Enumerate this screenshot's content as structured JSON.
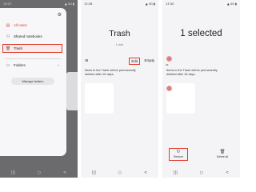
{
  "status": {
    "p1_time": "13:27",
    "p2_time": "13:28",
    "p3_time": "13:30",
    "system_right": "▲ 4G ▮"
  },
  "drawer": {
    "settings_icon": "gear-icon",
    "items": [
      {
        "label": "All notes",
        "icon": "note-icon"
      },
      {
        "label": "Shared notebooks",
        "icon": "people-icon"
      },
      {
        "label": "Trash",
        "icon": "trash-icon"
      },
      {
        "label": "Folders",
        "icon": "folder-icon"
      }
    ],
    "manage_folders": "Manage folders",
    "accent": "#e0392b"
  },
  "trash": {
    "title": "Trash",
    "count": "1 note",
    "edit": "Edit",
    "empty": "Empty",
    "notice": "Items in the Trash will be permanently deleted after 15 days."
  },
  "selection": {
    "title": "1 selected",
    "all_label": "All",
    "restore": "Restore",
    "delete_all": "Delete all"
  },
  "navbar": {
    "recents": "|||",
    "home": "○",
    "back": "<"
  }
}
